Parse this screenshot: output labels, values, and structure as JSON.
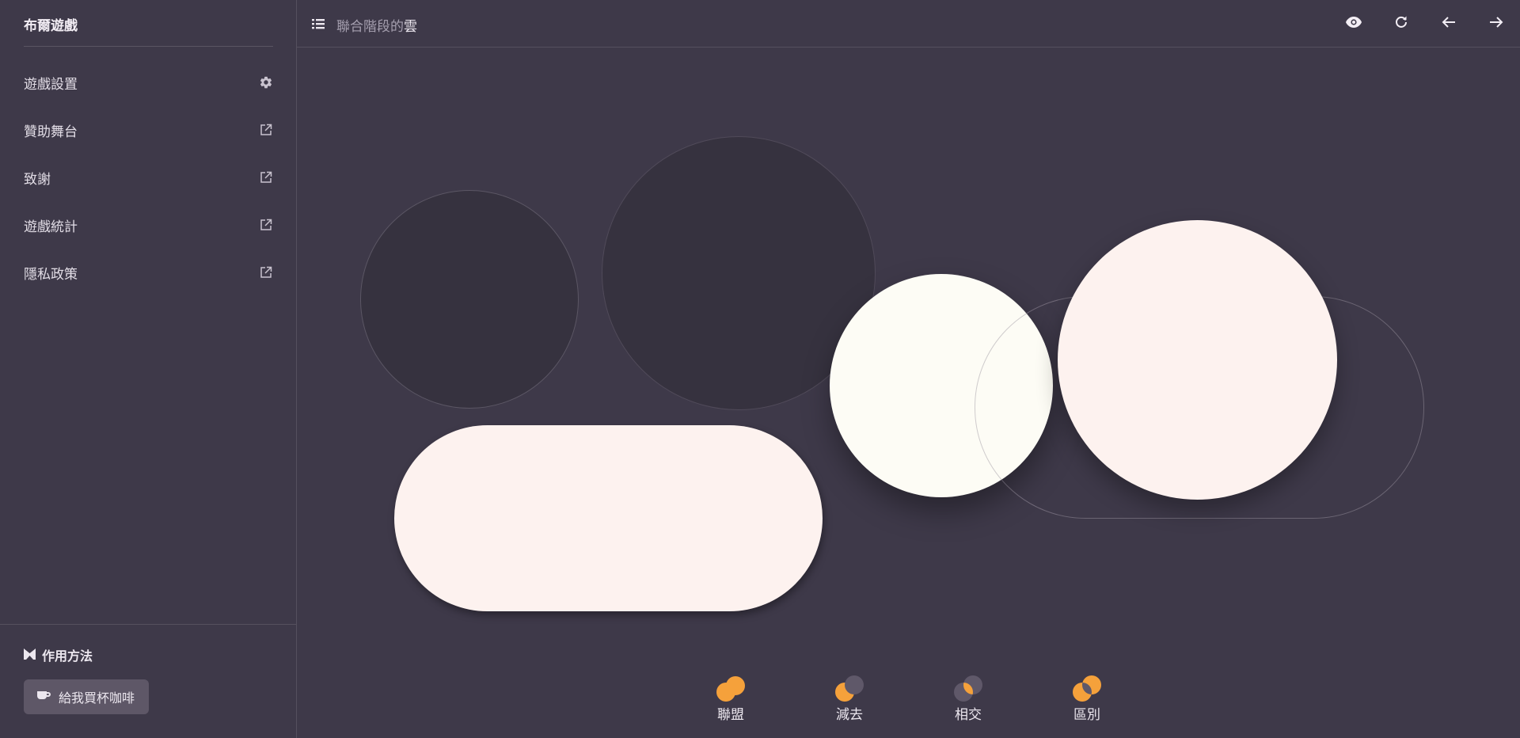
{
  "sidebar": {
    "title": "布爾遊戲",
    "items": [
      {
        "label": "遊戲設置",
        "icon": "gear-icon"
      },
      {
        "label": "贊助舞台",
        "icon": "external-link-icon"
      },
      {
        "label": "致謝",
        "icon": "external-link-icon"
      },
      {
        "label": "遊戲統計",
        "icon": "external-link-icon"
      },
      {
        "label": "隱私政策",
        "icon": "external-link-icon"
      }
    ],
    "howto_label": "作用方法",
    "coffee_label": "給我買杯咖啡"
  },
  "header": {
    "level_prefix": "聯合階段的",
    "level_highlight": "雲",
    "icons": [
      "eye-icon",
      "refresh-icon",
      "arrow-left-icon",
      "arrow-right-icon"
    ]
  },
  "operations": [
    {
      "label": "聯盟",
      "icon": "union-icon"
    },
    {
      "label": "減去",
      "icon": "subtract-icon"
    },
    {
      "label": "相交",
      "icon": "intersect-icon"
    },
    {
      "label": "區別",
      "icon": "difference-icon"
    }
  ],
  "colors": {
    "background": "#3e3949",
    "target_shape": "#36323f",
    "piece_cream": "#fdf2ef",
    "piece_ivory": "#fdfcf5",
    "accent": "#f5a13b"
  }
}
